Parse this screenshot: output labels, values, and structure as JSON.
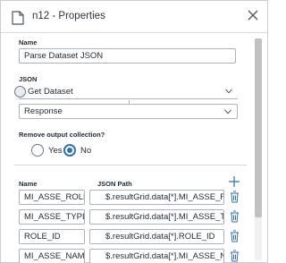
{
  "header": {
    "title": "n12 - Properties",
    "icon": "document-icon"
  },
  "name_section": {
    "label": "Name",
    "value": "Parse Dataset JSON"
  },
  "json_section": {
    "label": "JSON",
    "source_value": "Get Dataset",
    "field_value": "Response"
  },
  "remove_output": {
    "label": "Remove output collection?",
    "yes_label": "Yes",
    "no_label": "No",
    "selected": "No"
  },
  "mappings": {
    "name_header": "Name",
    "path_header": "JSON Path",
    "rows": [
      {
        "name": "MI_ASSE_ROLE_C",
        "path": "$.resultGrid.data[*].MI_ASSE_ROLE"
      },
      {
        "name": "MI_ASSE_TYPE_C",
        "path": "$.resultGrid.data[*].MI_ASSE_TYPE"
      },
      {
        "name": "ROLE_ID",
        "path": "$.resultGrid.data[*].ROLE_ID"
      },
      {
        "name": "MI_ASSE_NAME_(",
        "path": "$.resultGrid.data[*].MI_ASSE_NAM"
      }
    ]
  },
  "colors": {
    "accent": "#2f6fb5",
    "border": "#aab1b8",
    "text": "#1f2a36"
  }
}
